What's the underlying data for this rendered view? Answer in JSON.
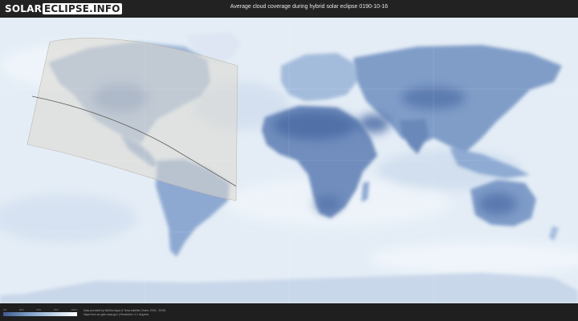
{
  "header": {
    "logo_part1": "SOLAR",
    "logo_part2": "ECLIPSE.INFO",
    "title": "Average cloud coverage during hybrid solar eclipse 0190-10-16"
  },
  "legend": {
    "ticks": [
      "0%",
      "25%",
      "50%",
      "75%",
      "100%"
    ],
    "gradient_colors": [
      "#3f5b8c",
      "#7d9dc6",
      "#bcd1e7",
      "#ffffff"
    ]
  },
  "credits": {
    "line1": "Data provided by NASAs Aqua & Terra satellite (Years: 2000 - 2019)",
    "line2": "https://neo.sci.gsfc.nasa.gov | Resolution: 0.1 degrees"
  },
  "map": {
    "ocean_color": "#e3ecf5",
    "land_cloud_color": "#5b7ab0",
    "eclipse_zone_color": "#d9d4cc"
  }
}
